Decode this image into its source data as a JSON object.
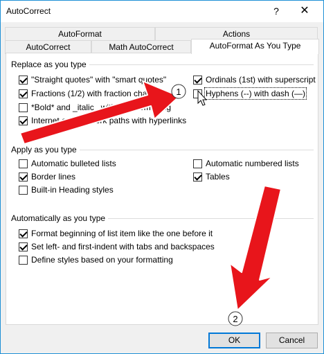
{
  "window": {
    "title": "AutoCorrect",
    "help_label": "?",
    "close_label": "✕"
  },
  "tabs": {
    "row_back": [
      {
        "label": "AutoFormat"
      },
      {
        "label": "Actions"
      }
    ],
    "row_front": [
      {
        "label": "AutoCorrect"
      },
      {
        "label": "Math AutoCorrect"
      },
      {
        "label": "AutoFormat As You Type"
      }
    ],
    "selected": "AutoFormat As You Type"
  },
  "replace": {
    "title": "Replace as you type",
    "items": [
      {
        "label": "\"Straight quotes\" with \"smart quotes\"",
        "checked": true
      },
      {
        "label": "Ordinals (1st) with superscript",
        "checked": true
      },
      {
        "label": "Fractions (1/2) with fraction character (½)",
        "checked": true
      },
      {
        "label": "Hyphens (--) with dash (—)",
        "checked": false
      },
      {
        "label": "*Bold* and _italic_ with real formatting",
        "checked": false
      },
      {
        "label": "Internet and network paths with hyperlinks",
        "checked": true
      }
    ]
  },
  "apply": {
    "title": "Apply as you type",
    "items": [
      {
        "label": "Automatic bulleted lists",
        "checked": false
      },
      {
        "label": "Automatic numbered lists",
        "checked": false
      },
      {
        "label": "Border lines",
        "checked": true
      },
      {
        "label": "Tables",
        "checked": true
      },
      {
        "label": "Built-in Heading styles",
        "checked": false
      }
    ]
  },
  "automatic": {
    "title": "Automatically as you type",
    "items": [
      {
        "label": "Format beginning of list item like the one before it",
        "checked": true
      },
      {
        "label": "Set left- and first-indent with tabs and backspaces",
        "checked": true
      },
      {
        "label": "Define styles based on your formatting",
        "checked": false
      }
    ]
  },
  "buttons": {
    "ok": "OK",
    "cancel": "Cancel"
  },
  "annotations": {
    "badge_1": "1",
    "badge_2": "2",
    "arrow_color": "#e8151b"
  }
}
